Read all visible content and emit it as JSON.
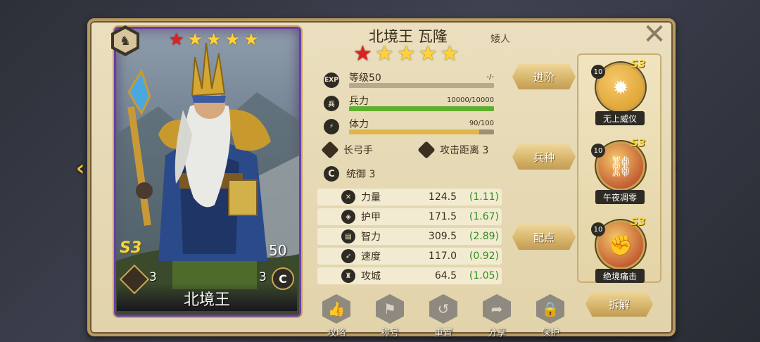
{
  "hero": {
    "card_name": "北境王",
    "title": "北境王 瓦隆",
    "race": "矮人",
    "card_stars": {
      "red": 1,
      "gold": 4
    },
    "top_stars": {
      "red": 1,
      "gold": 4
    },
    "season": "S3",
    "level_badge": "50",
    "left_badge_value": "3",
    "right_badge_value": "3",
    "right_badge_letter": "C"
  },
  "bars": [
    {
      "icon": "EXP",
      "label": "等级50",
      "value": "-/-",
      "fill": 1.0,
      "color": "#b8a98c"
    },
    {
      "icon": "兵",
      "label": "兵力",
      "value": "10000/10000",
      "fill": 1.0,
      "color": "#5fb02f"
    },
    {
      "icon": "⚡",
      "label": "体力",
      "value": "90/100",
      "fill": 0.9,
      "color": "#e0b64a"
    }
  ],
  "attributes": {
    "class": "长弓手",
    "range": "攻击距离 3",
    "command": "统御 3"
  },
  "stats": [
    {
      "name": "力量",
      "value": "124.5",
      "bonus": "(1.11)",
      "icon": "✕"
    },
    {
      "name": "护甲",
      "value": "171.5",
      "bonus": "(1.67)",
      "icon": "◈"
    },
    {
      "name": "智力",
      "value": "309.5",
      "bonus": "(2.89)",
      "icon": "▤"
    },
    {
      "name": "速度",
      "value": "117.0",
      "bonus": "(0.92)",
      "icon": "➶"
    },
    {
      "name": "攻城",
      "value": "64.5",
      "bonus": "(1.05)",
      "icon": "♜"
    }
  ],
  "buttons": {
    "advance": "进阶",
    "troop": "兵种",
    "points": "配点",
    "dismantle": "拆解"
  },
  "skills": [
    {
      "name": "无上威仪",
      "level": "10",
      "season": "S3",
      "icon": "✹",
      "color": "#d99a24"
    },
    {
      "name": "午夜凋零",
      "level": "10",
      "season": "S3",
      "icon": "⛓",
      "color": "#b0341e"
    },
    {
      "name": "绝境痛击",
      "level": "10",
      "season": "S3",
      "icon": "✊",
      "color": "#b0341e"
    }
  ],
  "bottom_menu": [
    {
      "label": "攻略",
      "icon": "👍"
    },
    {
      "label": "称号",
      "icon": "⚑"
    },
    {
      "label": "重置",
      "icon": "↺"
    },
    {
      "label": "分享",
      "icon": "➦"
    },
    {
      "label": "保护",
      "icon": "🔒"
    }
  ],
  "colors": {
    "panel": "#e6d8b2",
    "card_border": "#6a3ca8",
    "gold": "#ffd23a",
    "red_star": "#e02020",
    "bonus_green": "#2f8f1f"
  }
}
